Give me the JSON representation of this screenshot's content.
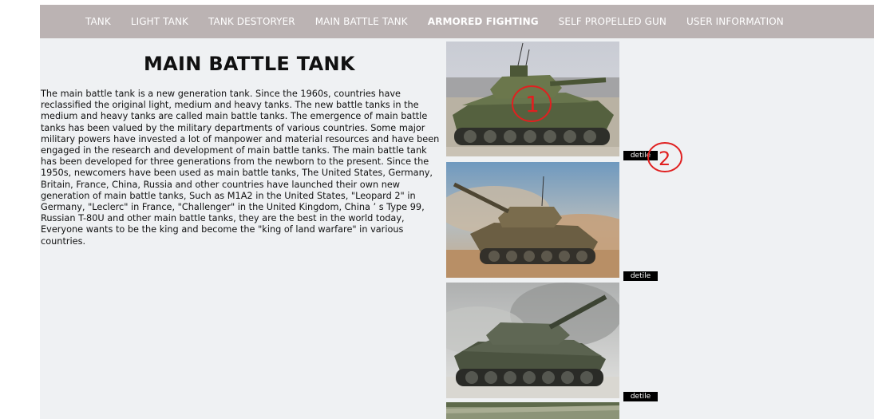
{
  "nav": {
    "items": [
      {
        "label": "TANK",
        "active": false
      },
      {
        "label": "LIGHT TANK",
        "active": false
      },
      {
        "label": "TANK DESTORYER",
        "active": false
      },
      {
        "label": "MAIN BATTLE TANK",
        "active": false
      },
      {
        "label": "ARMORED FIGHTING",
        "active": true
      },
      {
        "label": "SELF PROPELLED GUN",
        "active": false
      },
      {
        "label": "USER INFORMATION",
        "active": false
      }
    ]
  },
  "article": {
    "title": "MAIN BATTLE TANK",
    "body": "The main battle tank is a new generation tank. Since the 1960s, countries have reclassified the original light, medium and heavy tanks. The new battle tanks in the medium and heavy tanks are called main battle tanks. The emergence of main battle tanks has been valued by the military departments of various countries. Some major military powers have invested a lot of manpower and material resources and have been engaged in the research and development of main battle tanks. The main battle tank has been developed for three generations from the newborn to the present. Since the 1950s, newcomers have been used as main battle tanks, The United States, Germany, Britain, France, China, Russia and other countries have launched their own new generation of main battle tanks, Such as M1A2 in the United States, \"Leopard 2\" in Germany, \"Leclerc\" in France, \"Challenger\" in the United Kingdom, China ’ s Type 99, Russian T-80U and other main battle tanks, they are the best in the world today, Everyone wants to be the king and become the \"king of land warfare\" in various countries."
  },
  "gallery": {
    "cards": [
      {
        "detail_label": "detile"
      },
      {
        "detail_label": "detile"
      },
      {
        "detail_label": "detile"
      }
    ]
  },
  "annotations": {
    "marker_1": "1",
    "marker_2": "2"
  },
  "colors": {
    "nav_background": "#bbb3b3",
    "page_background": "#eff1f3",
    "annotation_red": "#e02020",
    "button_background": "#000000"
  }
}
